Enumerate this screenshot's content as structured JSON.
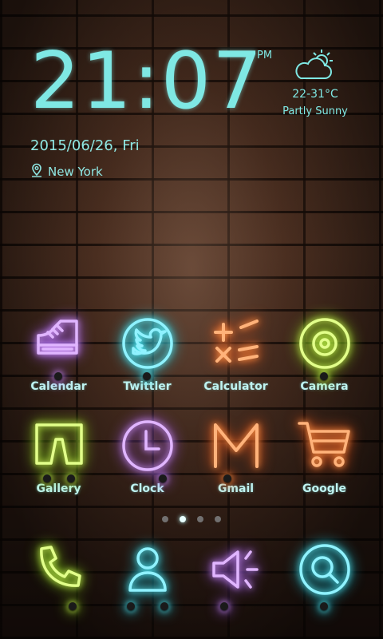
{
  "clock": {
    "time": "21:07",
    "ampm": "PM"
  },
  "date": "2015/06/26, Fri",
  "location": {
    "label": "New York",
    "icon": "location-pin-icon"
  },
  "weather": {
    "temp": "22-31°C",
    "condition": "Partly Sunny",
    "icon": "partly-cloudy-icon"
  },
  "apps_row1": [
    {
      "label": "Calendar",
      "icon": "sneaker-icon",
      "color": "#c77dff"
    },
    {
      "label": "Twittler",
      "icon": "bird-icon",
      "color": "#27d3ee"
    },
    {
      "label": "Calculator",
      "icon": "math-symbols-icon",
      "color": "#ff6b2a"
    },
    {
      "label": "Camera",
      "icon": "target-icon",
      "color": "#a6ea2a"
    }
  ],
  "apps_row2": [
    {
      "label": "Gallery",
      "icon": "shorts-icon",
      "color": "#a6ea2a"
    },
    {
      "label": "Clock",
      "icon": "clock-icon",
      "color": "#c77dff"
    },
    {
      "label": "Gmail",
      "icon": "letter-m-icon",
      "color": "#ff6b2a"
    },
    {
      "label": "Google",
      "icon": "cart-icon",
      "color": "#ff6b2a"
    }
  ],
  "page_indicator": {
    "count": 4,
    "active_index": 1
  },
  "dock": [
    {
      "icon": "phone-icon",
      "color": "#a6ea2a"
    },
    {
      "icon": "contact-icon",
      "color": "#27d3ee"
    },
    {
      "icon": "speaker-icon",
      "color": "#c77dff"
    },
    {
      "icon": "search-icon",
      "color": "#27d3ee"
    }
  ]
}
